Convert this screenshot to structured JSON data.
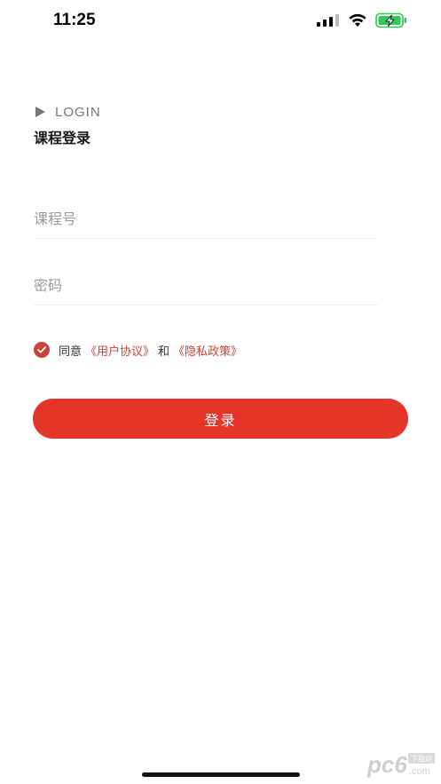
{
  "status_bar": {
    "time": "11:25",
    "battery_color": "#34c759"
  },
  "header": {
    "label_en": "LOGIN",
    "title": "课程登录"
  },
  "form": {
    "course_placeholder": "课程号",
    "course_value": "",
    "password_placeholder": "密码",
    "password_value": "",
    "agree_checked": true,
    "agree_prefix": "同意",
    "user_agreement": "《用户协议》",
    "and_text": "和",
    "privacy_policy": "《隐私政策》",
    "login_label": "登录"
  },
  "watermark": {
    "brand": "pc6",
    "badge": "下载站",
    "suffix": ".com"
  },
  "colors": {
    "accent": "#e63528",
    "link": "#c7453b"
  }
}
